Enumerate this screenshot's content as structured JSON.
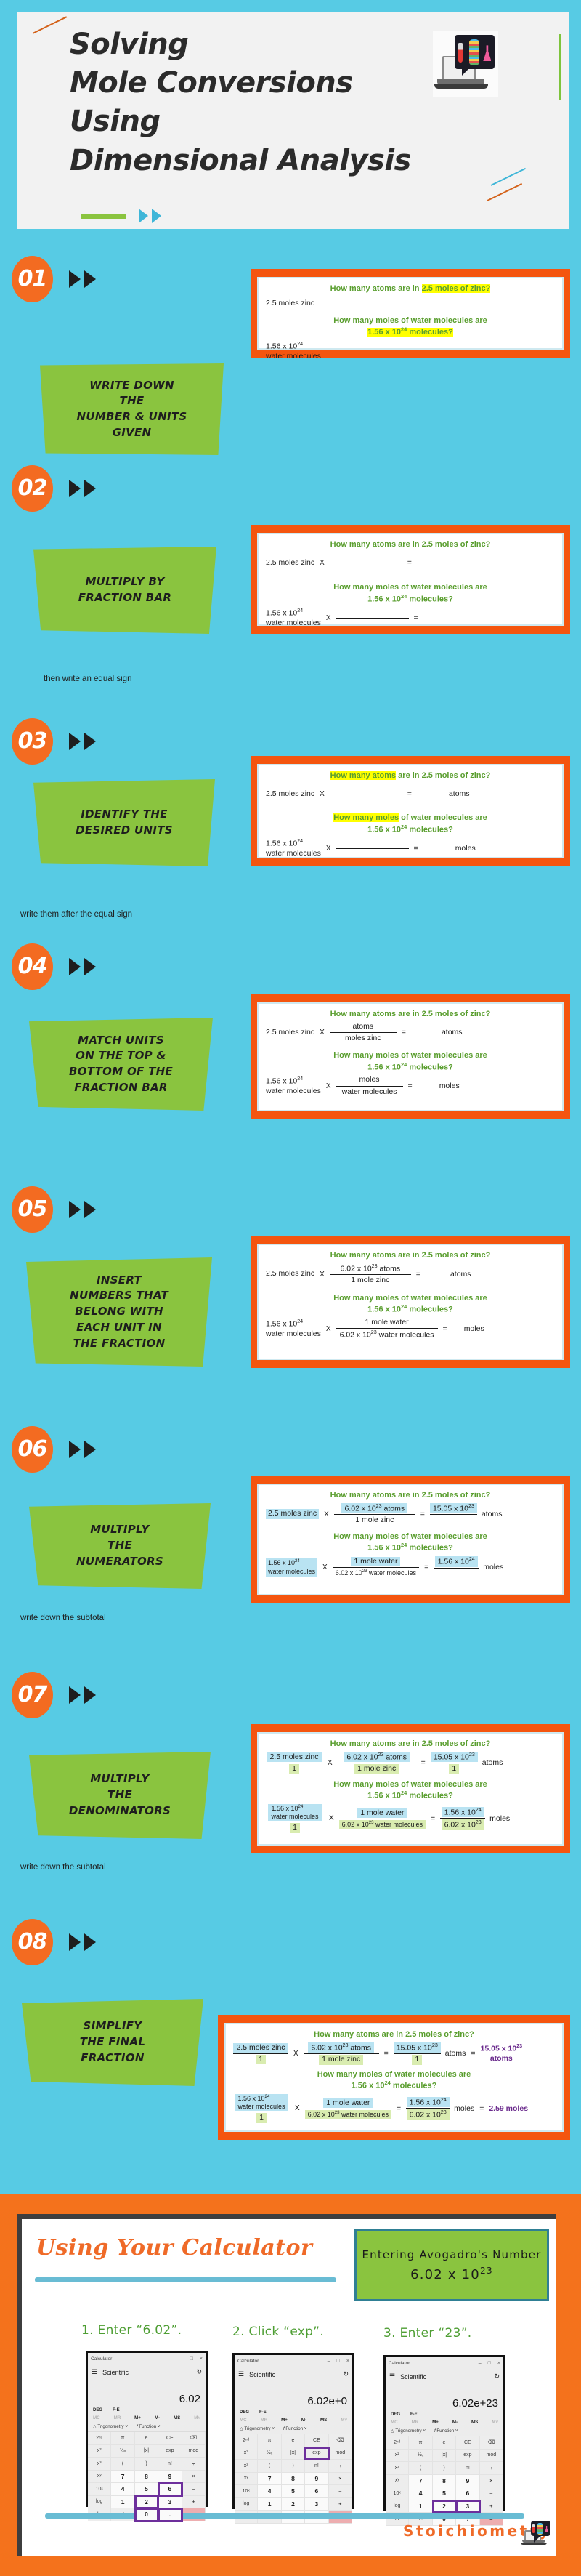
{
  "header": {
    "title_lines": [
      "Solving",
      "Mole Conversions",
      "Using",
      "Dimensional Analysis"
    ],
    "logo_icon": "laptop-dna-icon"
  },
  "colors": {
    "background": "#57cbe4",
    "accent_orange": "#f4550f",
    "badge_orange": "#f36b21",
    "green": "#8ac43f",
    "question_green": "#5a9e2f",
    "highlight_yellow": "#ffff00",
    "highlight_blue": "#b9e3f2",
    "highlight_green": "#d9ecb0",
    "answer_purple": "#6a2a8c",
    "panel_white": "#ffffff"
  },
  "problems": {
    "q1_prefix": "How many atoms are in ",
    "q1_highlight": "2.5 moles of zinc?",
    "q1_full": "How many atoms are in 2.5 moles of zinc?",
    "q1_hl_words": "How many atoms",
    "q1_rest": " are in 2.5 moles of zinc?",
    "q2_line1": "How many moles of water molecules are",
    "q2_line2": "1.56 x 10",
    "q2_line2_sup": "24",
    "q2_line2_tail": " molecules?",
    "q2_hl_words": "How many moles",
    "q2_rest": " of water molecules are",
    "given1": "2.5 moles zinc",
    "given2_a": "1.56 x 10",
    "given2_sup": "24",
    "given2_b": "water molecules"
  },
  "steps": [
    {
      "number": "01",
      "label": "WRITE DOWN THE NUMBER & UNITS GIVEN",
      "label_lines": [
        "WRITE DOWN",
        "THE",
        "NUMBER & UNITS",
        "GIVEN"
      ],
      "note": ""
    },
    {
      "number": "02",
      "label": "MULTIPLY BY FRACTION BAR",
      "label_lines": [
        "MULTIPLY BY",
        "FRACTION BAR"
      ],
      "note": "then write an equal sign"
    },
    {
      "number": "03",
      "label": "IDENTIFY THE DESIRED UNITS",
      "label_lines": [
        "IDENTIFY THE",
        "DESIRED UNITS"
      ],
      "note": "write them after the equal sign",
      "answer_unit_1": "atoms",
      "answer_unit_2": "moles"
    },
    {
      "number": "04",
      "label": "MATCH UNITS ON THE TOP & BOTTOM OF THE FRACTION BAR",
      "label_lines": [
        "MATCH UNITS",
        "ON THE TOP &",
        "BOTTOM OF THE",
        "FRACTION BAR"
      ],
      "note": "",
      "frac1_num": "atoms",
      "frac1_den": "moles zinc",
      "frac2_num": "moles",
      "frac2_den": "water molecules"
    },
    {
      "number": "05",
      "label": "INSERT NUMBERS THAT BELONG WITH EACH UNIT IN THE FRACTION",
      "label_lines": [
        "INSERT",
        "NUMBERS THAT",
        "BELONG WITH",
        "EACH UNIT IN",
        "THE FRACTION"
      ],
      "note": "",
      "frac1_num": "6.02 x 10²³ atoms",
      "frac1_den": "1 mole zinc",
      "frac2_num": "1 mole water",
      "frac2_den": "6.02 x 10²³ water molecules"
    },
    {
      "number": "06",
      "label": "MULTIPLY THE NUMERATORS",
      "label_lines": [
        "MULTIPLY",
        "THE",
        "NUMERATORS"
      ],
      "note": "write down the subtotal",
      "numerator_result_1": "15.05 x 10²³",
      "numerator_result_2": "1.56 x 10²⁴"
    },
    {
      "number": "07",
      "label": "MULTIPLY THE DENOMINATORS",
      "label_lines": [
        "MULTIPLY",
        "THE",
        "DENOMINATORS"
      ],
      "note": "write down the subtotal",
      "denominator_result_1": "1",
      "denominator_result_2": "6.02 x 10²³"
    },
    {
      "number": "08",
      "label": "SIMPLIFY THE FINAL FRACTION",
      "label_lines": [
        "SIMPLIFY",
        "THE FINAL",
        "FRACTION"
      ],
      "note": "",
      "final_answer_1": "15.05 x 10²³ atoms",
      "final_answer_2": "2.59 moles"
    }
  ],
  "math": {
    "given1": "2.5 moles zinc",
    "given1_den": "1",
    "given2_num_a": "1.56 x 10",
    "given2_sup": "24",
    "given2_num_b": "water molecules",
    "given2_den": "1",
    "f1_num": "6.02 x 10",
    "f1_num_sup": "23",
    "f1_num_tail": " atoms",
    "f1_den": "1 mole zinc",
    "f2_num": "1 mole water",
    "f2_den_a": "6.02 x 10",
    "f2_den_sup": "23",
    "f2_den_b": " water molecules",
    "r1_num": "15.05 x 10",
    "r1_num_sup": "23",
    "r1_den": "1",
    "r2_num": "1.56 x 10",
    "r2_num_sup": "24",
    "r2_den": "6.02 x 10",
    "r2_den_sup": "23",
    "unit_atoms": "atoms",
    "unit_moles": "moles",
    "final1_a": "15.05 x 10",
    "final1_sup": "23",
    "final1_b": "atoms",
    "final2": "2.59 moles",
    "units_blank_atoms": "atoms",
    "units_blank_moles": "moles"
  },
  "calculator_section": {
    "title": "Using Your Calculator",
    "avogadro_line1": "Entering Avogadro's Number",
    "avogadro_line2_a": "6.02 x 10",
    "avogadro_line2_sup": "23",
    "steps": [
      {
        "label": "1. Enter “6.02”.",
        "display": "6.02",
        "highlight_keys": [
          "6",
          "0",
          "2",
          "."
        ]
      },
      {
        "label": "2.  Click “exp”.",
        "display": "6.02e+0",
        "highlight_keys": [
          "exp"
        ]
      },
      {
        "label": "3.  Enter “23”.",
        "display": "6.02e+23",
        "highlight_keys": [
          "2",
          "3"
        ]
      }
    ],
    "window": {
      "app_title": "Calculator",
      "minimize": "–",
      "maximize": "□",
      "close": "×",
      "menu_icon": "hamburger-icon",
      "mode": "Scientific",
      "history_icon": "history-icon",
      "deg": "DEG",
      "fe": "F-E",
      "memory": [
        "MC",
        "MR",
        "M+",
        "M-",
        "MS",
        "M˅"
      ],
      "trig": "Trigonometry",
      "function": "Function",
      "keys": [
        "2ⁿᵈ",
        "π",
        "e",
        "CE",
        "⌫",
        "x²",
        "½ₓ",
        "|x|",
        "exp",
        "mod",
        "x³",
        "(",
        ")",
        "n!",
        "÷",
        "xʸ",
        "7",
        "8",
        "9",
        "×",
        "10ˣ",
        "4",
        "5",
        "6",
        "−",
        "log",
        "1",
        "2",
        "3",
        "+",
        "ln",
        "⁺⁄₋",
        "0",
        ".",
        "="
      ]
    }
  },
  "footer": {
    "word": "Stoichiometry",
    "logo_icon": "laptop-dna-icon"
  }
}
